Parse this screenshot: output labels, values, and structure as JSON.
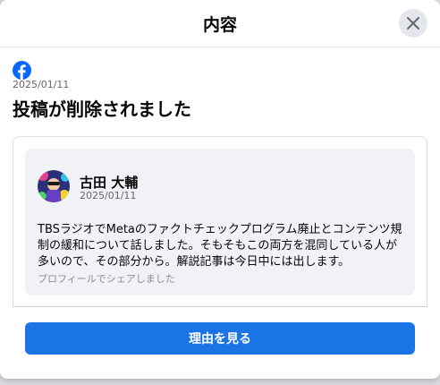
{
  "dialog": {
    "title": "内容",
    "close_icon": "close-icon"
  },
  "post": {
    "logo_icon": "facebook-logo-icon",
    "date": "2025/01/11",
    "headline": "投稿が削除されました"
  },
  "shared_post": {
    "author_name": "古田 大輔",
    "author_date": "2025/01/11",
    "text": "TBSラジオでMetaのファクトチェックプログラム廃止とコンテンツ規制の緩和について話しました。そもそもこの両方を混同している人が多いので、その部分から。解説記事は今日中には出します。",
    "shared_note": "プロフィールでシェアしました"
  },
  "actions": {
    "reason_button_label": "理由を見る"
  },
  "colors": {
    "primary": "#1b74e4",
    "facebook_blue": "#0866ff",
    "secondary_text": "#65676b"
  }
}
